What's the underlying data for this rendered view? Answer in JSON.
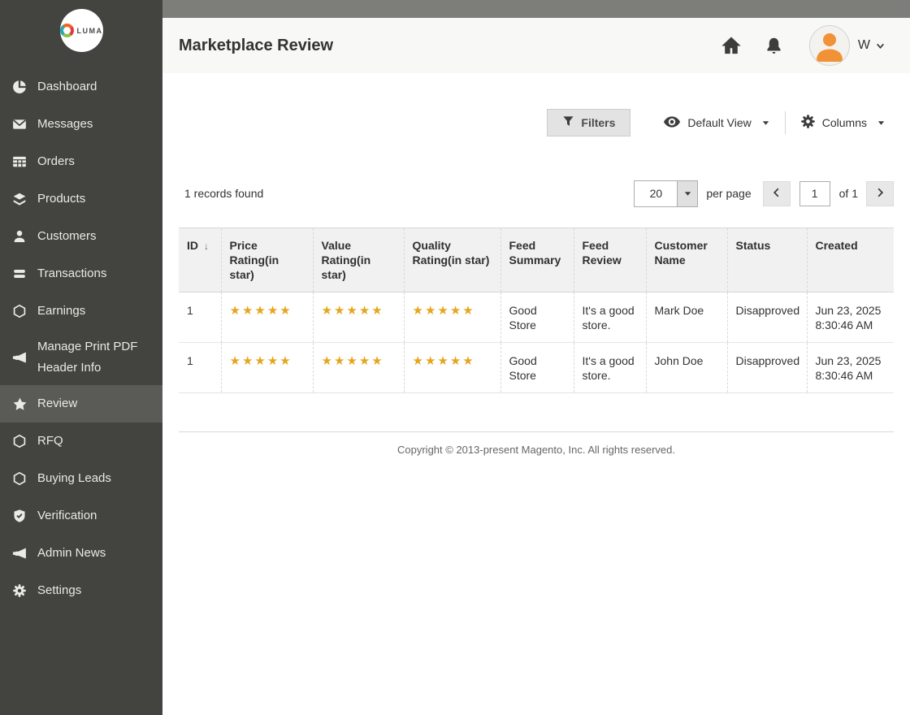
{
  "sidebar": {
    "logo_text": "LUMA",
    "items": [
      {
        "label": "Dashboard",
        "icon": "dashboard-icon"
      },
      {
        "label": "Messages",
        "icon": "messages-icon"
      },
      {
        "label": "Orders",
        "icon": "orders-icon"
      },
      {
        "label": "Products",
        "icon": "products-icon"
      },
      {
        "label": "Customers",
        "icon": "customers-icon"
      },
      {
        "label": "Transactions",
        "icon": "transactions-icon"
      },
      {
        "label": "Earnings",
        "icon": "hexagon-icon"
      },
      {
        "label": "Manage Print PDF Header Info",
        "icon": "megaphone-icon"
      },
      {
        "label": "Review",
        "icon": "star-icon",
        "active": true
      },
      {
        "label": "RFQ",
        "icon": "hexagon-icon"
      },
      {
        "label": "Buying Leads",
        "icon": "hexagon-icon"
      },
      {
        "label": "Verification",
        "icon": "shield-check-icon"
      },
      {
        "label": "Admin News",
        "icon": "megaphone-icon"
      },
      {
        "label": "Settings",
        "icon": "gear-icon"
      }
    ]
  },
  "header": {
    "title": "Marketplace Review",
    "user_initial": "W",
    "icons": [
      "home-icon",
      "bell-icon",
      "avatar",
      "chevron-down-icon"
    ]
  },
  "toolbar": {
    "filters_label": "Filters",
    "view_label": "Default View",
    "columns_label": "Columns",
    "icons": [
      "funnel-icon",
      "eye-icon",
      "gear-icon"
    ]
  },
  "grid_controls": {
    "records_found": "1 records found",
    "per_page_value": "20",
    "per_page_label": "per page",
    "page_value": "1",
    "of_label": "of 1"
  },
  "table": {
    "columns": [
      "ID",
      "Price Rating(in star)",
      "Value Rating(in star)",
      "Quality Rating(in star)",
      "Feed Summary",
      "Feed Review",
      "Customer Name",
      "Status",
      "Created"
    ],
    "sort_indicator": "↓",
    "rows": [
      {
        "id": "1",
        "price_rating": 5,
        "value_rating": 5,
        "quality_rating": 5,
        "feed_summary": "Good Store",
        "feed_review": "It's a good store.",
        "customer_name": "Mark Doe",
        "status": "Disapproved",
        "created": "Jun 23, 2025 8:30:46 AM"
      },
      {
        "id": "1",
        "price_rating": 5,
        "value_rating": 5,
        "quality_rating": 5,
        "feed_summary": "Good Store",
        "feed_review": "It's a good store.",
        "customer_name": "John Doe",
        "status": "Disapproved",
        "created": "Jun 23, 2025 8:30:46 AM"
      }
    ]
  },
  "footer": {
    "copyright": "Copyright © 2013-present Magento, Inc. All rights reserved."
  },
  "colors": {
    "sidebar_bg": "#434440",
    "sidebar_active_bg": "#5a5b57",
    "top_strip": "#7d7e7a",
    "header_bg": "#f8f8f7",
    "star_gold": "#e6a51c",
    "avatar_orange": "#f09235"
  }
}
